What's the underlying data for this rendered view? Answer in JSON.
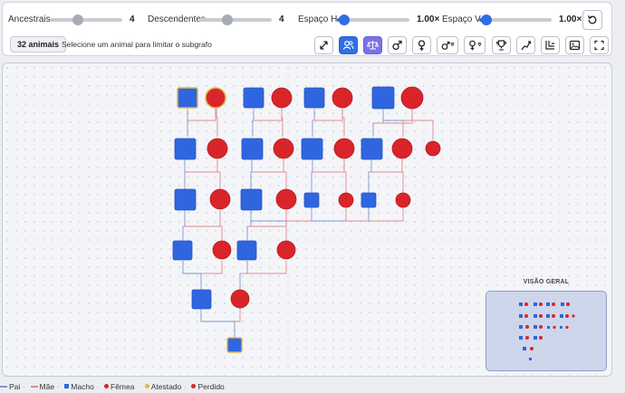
{
  "controls": {
    "ancestors": {
      "label": "Ancestrais",
      "value": "4",
      "level": 0.45
    },
    "descendants": {
      "label": "Descendentes",
      "value": "4",
      "level": 0.45
    },
    "spacing_h": {
      "label": "Espaço H",
      "value": "1.00×",
      "level": 0.05
    },
    "spacing_v": {
      "label": "Espaço V",
      "value": "1.00×",
      "level": 0.05
    }
  },
  "status": {
    "animal_count": "32 animais",
    "hint": "Selecione um animal para limitar o subgrafo"
  },
  "toolbar_icons": [
    "fit-icon",
    "people-icon",
    "balance-icon",
    "male-icon",
    "female-icon",
    "male-filter-icon",
    "female-filter-icon",
    "trophy-icon",
    "flag-icon",
    "layout-icon",
    "image-icon",
    "fullscreen-icon"
  ],
  "minimap": {
    "title": "VISÃO GERAL"
  },
  "legend": {
    "sire": "Pai",
    "dam": "Mãe",
    "male": "Macho",
    "female": "Fêmea",
    "certified": "Atestado",
    "lost": "Perdido"
  },
  "colors": {
    "male": "#2f66e0",
    "female": "#d9252a",
    "sire_line": "#7c96d4",
    "dam_line": "#e08a90",
    "highlight": "#e0b64a",
    "accent": "#2f6fe4"
  }
}
